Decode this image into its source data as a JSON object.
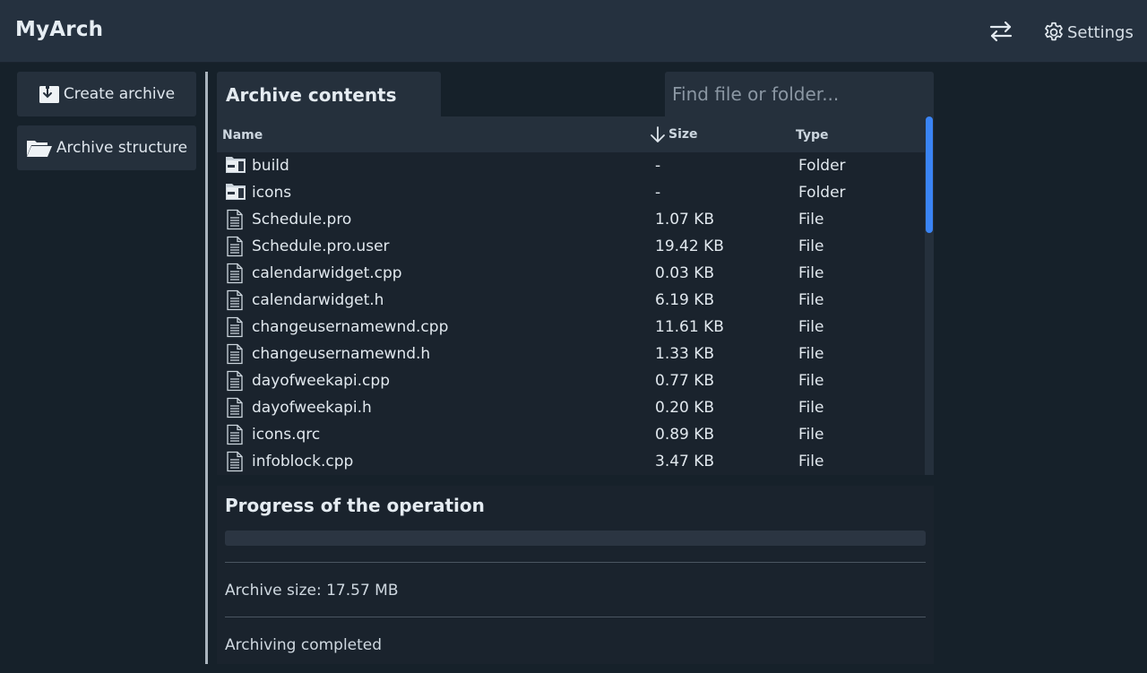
{
  "header": {
    "title": "MyArch",
    "settings_label": "Settings",
    "swap_icon": "swap-arrows-icon",
    "settings_icon": "gear-icon"
  },
  "sidebar": {
    "create_label": "Create archive",
    "structure_label": "Archive structure"
  },
  "contents": {
    "title": "Archive contents",
    "search_placeholder": "Find file or folder...",
    "columns": {
      "name": "Name",
      "size": "Size",
      "type": "Type"
    },
    "sort": "size-descending",
    "rows": [
      {
        "name": "build",
        "size": "-",
        "type": "Folder",
        "icon": "folder-icon"
      },
      {
        "name": "icons",
        "size": "-",
        "type": "Folder",
        "icon": "folder-icon"
      },
      {
        "name": "Schedule.pro",
        "size": "1.07 KB",
        "type": "File",
        "icon": "file-icon"
      },
      {
        "name": "Schedule.pro.user",
        "size": "19.42 KB",
        "type": "File",
        "icon": "file-icon"
      },
      {
        "name": "calendarwidget.cpp",
        "size": "0.03 KB",
        "type": "File",
        "icon": "file-icon"
      },
      {
        "name": "calendarwidget.h",
        "size": "6.19 KB",
        "type": "File",
        "icon": "file-icon"
      },
      {
        "name": "changeusernamewnd.cpp",
        "size": "11.61 KB",
        "type": "File",
        "icon": "file-icon"
      },
      {
        "name": "changeusernamewnd.h",
        "size": "1.33 KB",
        "type": "File",
        "icon": "file-icon"
      },
      {
        "name": "dayofweekapi.cpp",
        "size": "0.77 KB",
        "type": "File",
        "icon": "file-icon"
      },
      {
        "name": "dayofweekapi.h",
        "size": "0.20 KB",
        "type": "File",
        "icon": "file-icon"
      },
      {
        "name": "icons.qrc",
        "size": "0.89 KB",
        "type": "File",
        "icon": "file-icon"
      },
      {
        "name": "infoblock.cpp",
        "size": "3.47 KB",
        "type": "File",
        "icon": "file-icon"
      }
    ]
  },
  "progress": {
    "title": "Progress of the operation",
    "percent": 0,
    "archive_size": "Archive size: 17.57 MB",
    "status": "Archiving completed"
  },
  "colors": {
    "accent": "#3a84f5",
    "header_bg": "#25313f",
    "page_bg": "#16212a"
  }
}
